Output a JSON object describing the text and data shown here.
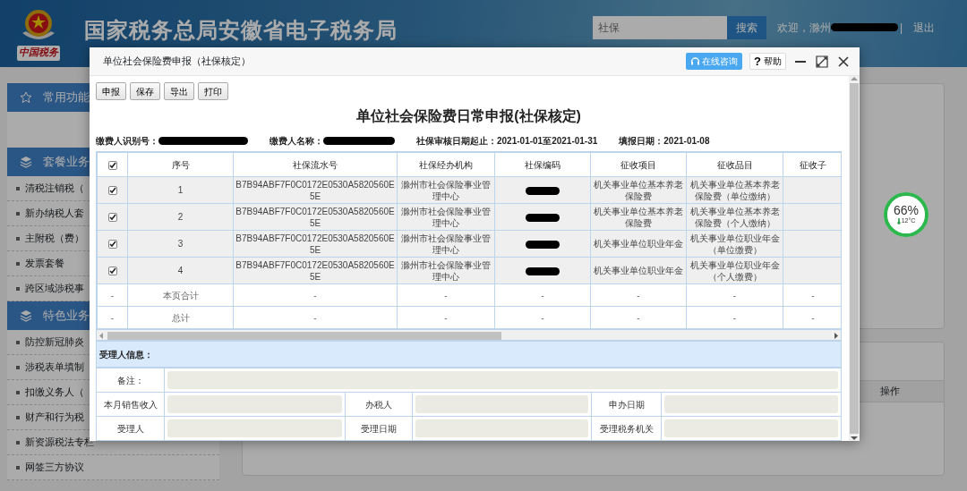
{
  "header": {
    "title": "国家税务总局安徽省电子税务局",
    "logo_caption": "中国税务",
    "search": {
      "placeholder": "社保",
      "button": "搜索"
    },
    "welcome": "欢迎，滁州",
    "separator": "|",
    "logout": "退出"
  },
  "sidebar": [
    {
      "title": "常用功能"
    },
    {
      "title": "套餐业务",
      "items": [
        "清税注销税（",
        "新办纳税人套",
        "主附税（费）",
        "发票套餐",
        "跨区域涉税事"
      ]
    },
    {
      "title": "特色业务",
      "items": [
        "防控新冠肺炎",
        "涉税表单填制",
        "扣缴义务人（",
        "财产和行为税",
        "新资源税法专栏",
        "网签三方协议"
      ]
    }
  ],
  "main_panel": {
    "column_header": "操作"
  },
  "widget": {
    "percent": "66%",
    "temperature": "12°C"
  },
  "dialog": {
    "title": "单位社会保险费申报（社保核定）",
    "consult_button": "在线咨询",
    "help": {
      "icon": "?",
      "label": "帮助"
    },
    "toolbar": [
      "申报",
      "保存",
      "导出",
      "打印"
    ],
    "heading": "单位社会保险费日常申报(社保核定)",
    "info": [
      {
        "text": "缴费人识别号：",
        "redacted": true
      },
      {
        "text": "缴费人名称：",
        "redacted": true
      },
      {
        "text": "社保审核日期起止：2021-01-01至2021-01-31",
        "redacted": false
      },
      {
        "text": "填报日期：2021-01-08",
        "redacted": false
      }
    ],
    "table": {
      "all_checked": true,
      "columns": [
        "序号",
        "社保流水号",
        "社保经办机构",
        "社保编码",
        "征收项目",
        "征收品目",
        "征收子"
      ],
      "rows": [
        {
          "kind": "data",
          "checked": true,
          "no": "1",
          "serial": "B7B94ABF7F0C0172E0530A5820560E5E",
          "agency": "滁州市社会保险事业管理中心",
          "code_redacted": true,
          "item": "机关事业单位基本养老保险费",
          "category": "机关事业单位基本养老保险费（单位缴纳）"
        },
        {
          "kind": "data",
          "checked": true,
          "no": "2",
          "serial": "B7B94ABF7F0C0172E0530A5820560E5E",
          "agency": "滁州市社会保险事业管理中心",
          "code_redacted": true,
          "item": "机关事业单位基本养老保险费",
          "category": "机关事业单位基本养老保险费（个人缴纳）"
        },
        {
          "kind": "data",
          "checked": true,
          "no": "3",
          "serial": "B7B94ABF7F0C0172E0530A5820560E5E",
          "agency": "滁州市社会保险事业管理中心",
          "code_redacted": true,
          "item": "机关事业单位职业年金",
          "category": "机关事业单位职业年金（单位缴费）"
        },
        {
          "kind": "data",
          "checked": true,
          "no": "4",
          "serial": "B7B94ABF7F0C0172E0530A5820560E5E",
          "agency": "滁州市社会保险事业管理中心",
          "code_redacted": true,
          "item": "机关事业单位职业年金",
          "category": "机关事业单位职业年金（个人缴费）"
        },
        {
          "kind": "total",
          "mark": "-",
          "label": "本页合计",
          "values": [
            "-",
            "-",
            "-",
            "-",
            "-",
            "-"
          ]
        },
        {
          "kind": "total",
          "mark": "-",
          "label": "总计",
          "values": [
            "-",
            "-",
            "-",
            "-",
            "-",
            "-"
          ]
        }
      ]
    },
    "form": {
      "title": "受理人信息：",
      "rows": [
        [
          {
            "label": "备注：",
            "disabled": true
          }
        ],
        [
          {
            "label": "本月销售收入",
            "disabled": true
          },
          {
            "label": "办税人",
            "disabled": true
          },
          {
            "label": "申办日期",
            "disabled": true
          }
        ],
        [
          {
            "label": "受理人",
            "disabled": true
          },
          {
            "label": "受理日期",
            "disabled": true
          },
          {
            "label": "受理税务机关",
            "disabled": true
          }
        ]
      ]
    }
  }
}
